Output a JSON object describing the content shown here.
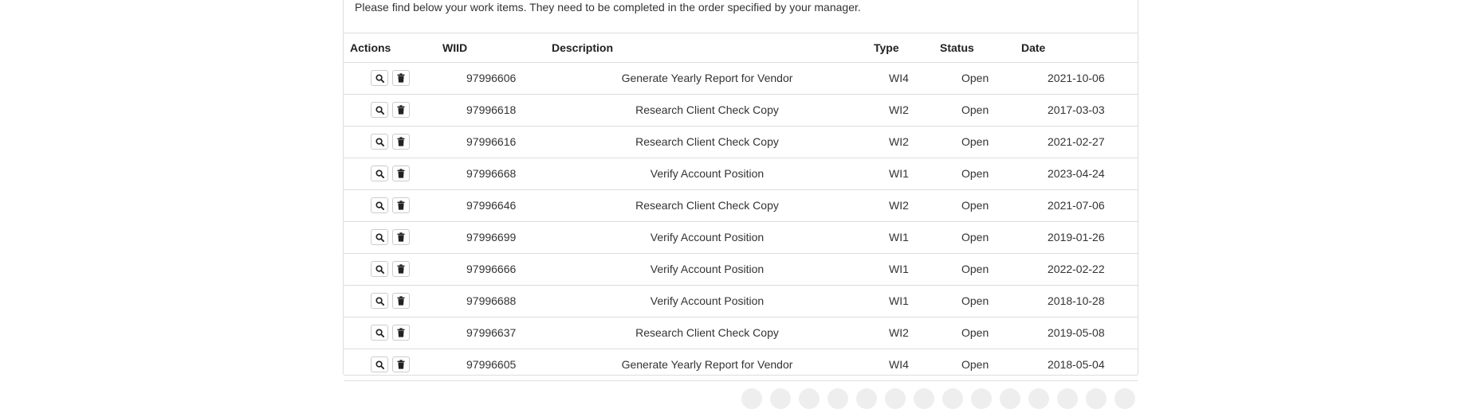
{
  "intro_text": "Please find below your work items. They need to be completed in the order specified by your manager.",
  "table": {
    "headers": {
      "actions": "Actions",
      "wiid": "WIID",
      "description": "Description",
      "type": "Type",
      "status": "Status",
      "date": "Date"
    },
    "rows": [
      {
        "wiid": "97996606",
        "description": "Generate Yearly Report for Vendor",
        "type": "WI4",
        "status": "Open",
        "date": "2021-10-06"
      },
      {
        "wiid": "97996618",
        "description": "Research Client Check Copy",
        "type": "WI2",
        "status": "Open",
        "date": "2017-03-03"
      },
      {
        "wiid": "97996616",
        "description": "Research Client Check Copy",
        "type": "WI2",
        "status": "Open",
        "date": "2021-02-27"
      },
      {
        "wiid": "97996668",
        "description": "Verify Account Position",
        "type": "WI1",
        "status": "Open",
        "date": "2023-04-24"
      },
      {
        "wiid": "97996646",
        "description": "Research Client Check Copy",
        "type": "WI2",
        "status": "Open",
        "date": "2021-07-06"
      },
      {
        "wiid": "97996699",
        "description": "Verify Account Position",
        "type": "WI1",
        "status": "Open",
        "date": "2019-01-26"
      },
      {
        "wiid": "97996666",
        "description": "Verify Account Position",
        "type": "WI1",
        "status": "Open",
        "date": "2022-02-22"
      },
      {
        "wiid": "97996688",
        "description": "Verify Account Position",
        "type": "WI1",
        "status": "Open",
        "date": "2018-10-28"
      },
      {
        "wiid": "97996637",
        "description": "Research Client Check Copy",
        "type": "WI2",
        "status": "Open",
        "date": "2019-05-08"
      },
      {
        "wiid": "97996605",
        "description": "Generate Yearly Report for Vendor",
        "type": "WI4",
        "status": "Open",
        "date": "2018-05-04"
      }
    ],
    "action_icons": [
      "search-icon",
      "trash-icon"
    ]
  },
  "pagination": {
    "items": [
      "",
      "",
      "",
      "",
      "",
      "",
      "",
      "",
      "",
      "",
      "",
      "",
      "",
      ""
    ]
  },
  "colors": {
    "border": "#dddddd",
    "text": "#333333",
    "header_text": "#222222"
  }
}
